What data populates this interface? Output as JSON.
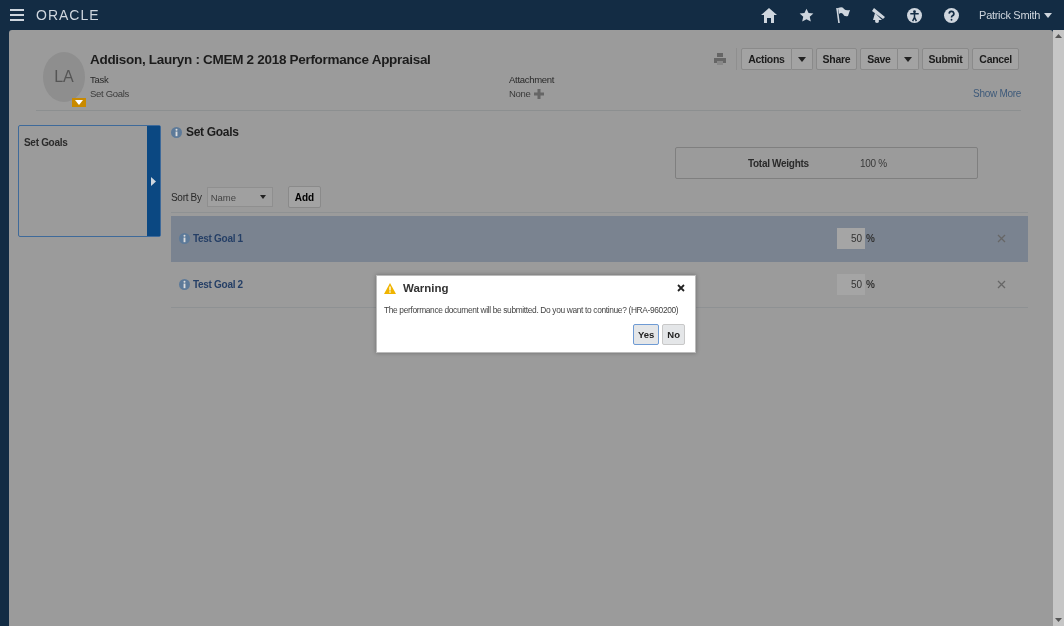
{
  "header": {
    "brand": "ORACLE",
    "user": "Patrick Smith"
  },
  "document": {
    "initials": "LA",
    "title": "Addison, Lauryn : CMEM 2 2018 Performance Appraisal",
    "task_label": "Task",
    "task_value": "Set Goals",
    "attachment_label": "Attachment",
    "attachment_value": "None",
    "show_more": "Show More"
  },
  "toolbar": [
    {
      "label": "Actions",
      "kind": "split"
    },
    {
      "label": "Share",
      "kind": "plain"
    },
    {
      "label": "Save",
      "kind": "split"
    },
    {
      "label": "Submit",
      "kind": "plain"
    },
    {
      "label": "Cancel",
      "kind": "plain"
    }
  ],
  "sidebar": {
    "items": [
      {
        "label": "Set Goals",
        "selected": true
      }
    ]
  },
  "section": {
    "title": "Set Goals",
    "total_label": "Total Weights",
    "total_value": "100 %",
    "sort_label": "Sort By",
    "sort_value": "Name",
    "add_button": "Add"
  },
  "goals": [
    {
      "name": "Test Goal 1",
      "weight": "50",
      "unit": "%",
      "selected": true
    },
    {
      "name": "Test Goal 2",
      "weight": "50",
      "unit": "%",
      "selected": false
    }
  ],
  "dialog": {
    "title": "Warning",
    "message": "The performance document will be submitted. Do you want to continue? (HRA-960200)",
    "buttons": [
      {
        "label": "Yes",
        "focused": true
      },
      {
        "label": "No",
        "focused": false
      }
    ]
  }
}
